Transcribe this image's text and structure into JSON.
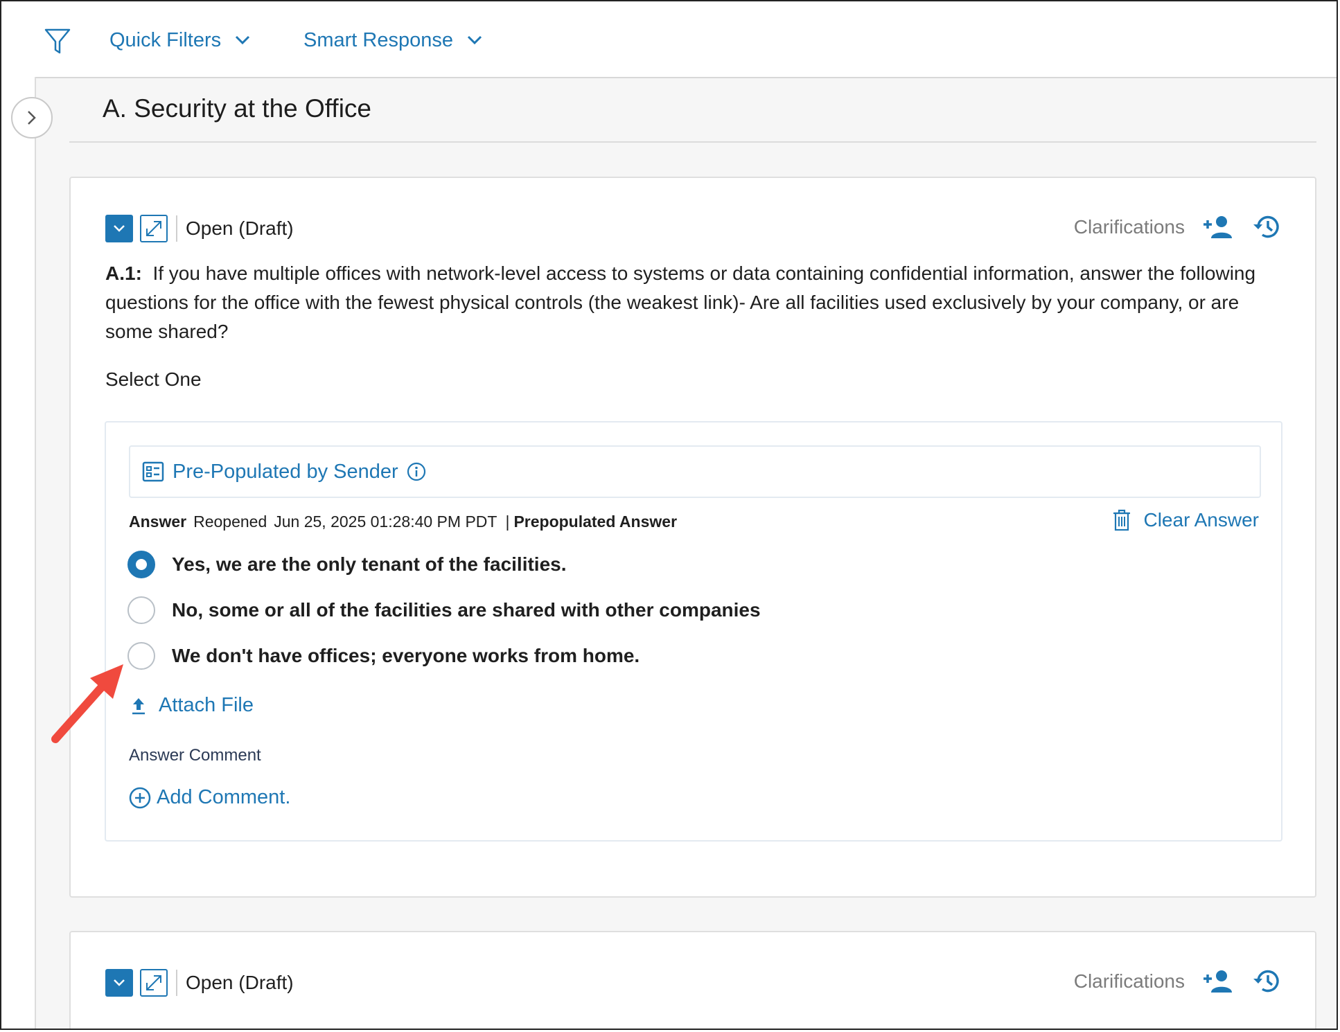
{
  "toolbar": {
    "filter_icon": "filter-icon",
    "quick_filters": "Quick Filters",
    "smart_response": "Smart Response"
  },
  "section": {
    "title": "A. Security at the Office"
  },
  "question": {
    "status": "Open (Draft)",
    "clarifications": "Clarifications",
    "id": "A.1:",
    "text": "If you have multiple offices with network-level access to systems or data containing confidential information, answer the following questions for the office with the fewest physical controls (the weakest link)- Are all facilities used exclusively by your company, or are some shared?",
    "select_hint": "Select One",
    "prepopulated_label": "Pre-Populated by Sender",
    "answer": {
      "label": "Answer",
      "state": "Reopened",
      "timestamp": "Jun 25, 2025 01:28:40 PM PDT",
      "separator": "|",
      "source": "Prepopulated Answer",
      "clear_label": "Clear Answer"
    },
    "options": [
      {
        "label": "Yes, we are the only tenant of the facilities.",
        "selected": true
      },
      {
        "label": "No, some or all of the facilities are shared with other companies",
        "selected": false
      },
      {
        "label": "We don't have offices; everyone works from home.",
        "selected": false
      }
    ],
    "attach_label": "Attach File",
    "comment_label": "Answer Comment",
    "add_comment": "Add Comment."
  },
  "next_question": {
    "status": "Open (Draft)",
    "clarifications": "Clarifications"
  },
  "colors": {
    "accent": "#1e77b4",
    "annotation_arrow": "#f04a3e"
  }
}
